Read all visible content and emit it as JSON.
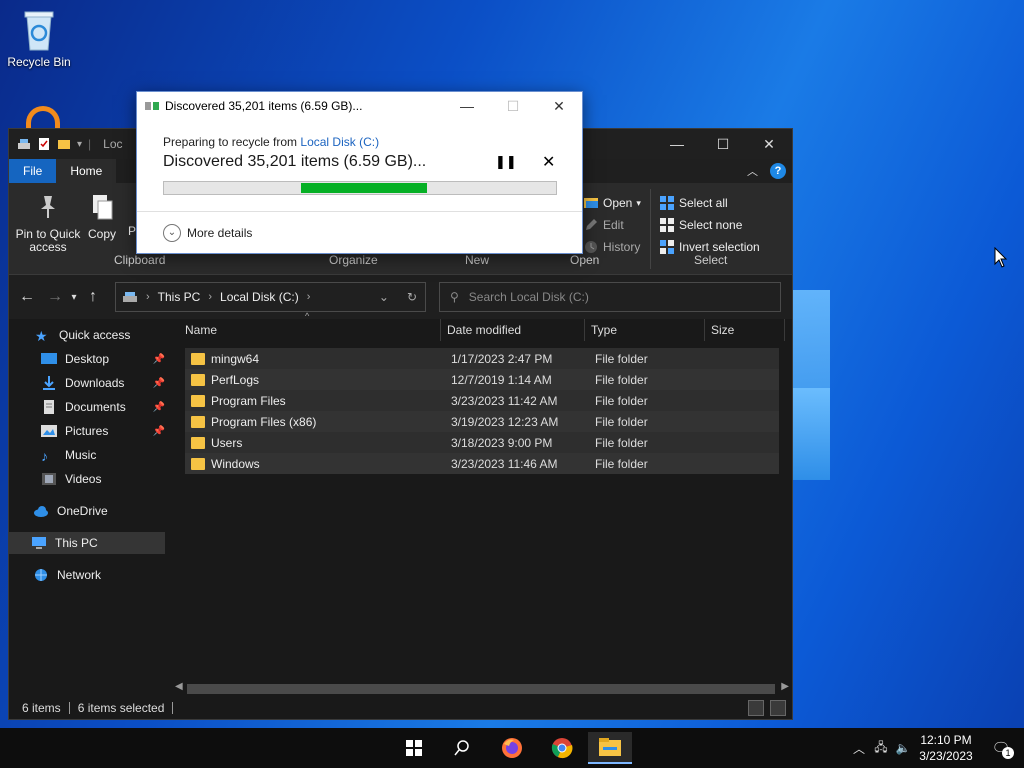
{
  "desktop": {
    "icons": [
      {
        "label": "Recycle Bin"
      }
    ]
  },
  "explorer": {
    "title_short": "Loc",
    "tabs": [
      "File",
      "Home"
    ],
    "ribbon": {
      "pin_label_1": "Pin to Quick",
      "pin_label_2": "access",
      "copy_label": "Copy",
      "paste_label": "P",
      "open_label": "Open",
      "edit_label": "Edit",
      "history_label": "History",
      "select_all": "Select all",
      "select_none": "Select none",
      "invert_selection": "Invert selection",
      "groups": {
        "clipboard": "Clipboard",
        "organize": "Organize",
        "new": "New",
        "open": "Open",
        "select": "Select"
      }
    },
    "address": {
      "parts": [
        "This PC",
        "Local Disk (C:)"
      ]
    },
    "search": {
      "placeholder": "Search Local Disk (C:)"
    },
    "nav": {
      "quick_access": "Quick access",
      "items": [
        {
          "label": "Desktop",
          "pinned": true
        },
        {
          "label": "Downloads",
          "pinned": true
        },
        {
          "label": "Documents",
          "pinned": true
        },
        {
          "label": "Pictures",
          "pinned": true
        },
        {
          "label": "Music",
          "pinned": false
        },
        {
          "label": "Videos",
          "pinned": false
        }
      ],
      "onedrive": "OneDrive",
      "this_pc": "This PC",
      "network": "Network"
    },
    "columns": [
      "Name",
      "Date modified",
      "Type",
      "Size"
    ],
    "files": [
      {
        "name": "mingw64",
        "date": "1/17/2023 2:47 PM",
        "type": "File folder"
      },
      {
        "name": "PerfLogs",
        "date": "12/7/2019 1:14 AM",
        "type": "File folder"
      },
      {
        "name": "Program Files",
        "date": "3/23/2023 11:42 AM",
        "type": "File folder"
      },
      {
        "name": "Program Files (x86)",
        "date": "3/19/2023 12:23 AM",
        "type": "File folder"
      },
      {
        "name": "Users",
        "date": "3/18/2023 9:00 PM",
        "type": "File folder"
      },
      {
        "name": "Windows",
        "date": "3/23/2023 11:46 AM",
        "type": "File folder"
      }
    ],
    "status": {
      "items": "6 items",
      "selected": "6 items selected"
    }
  },
  "dialog": {
    "title": "Discovered 35,201 items (6.59 GB)...",
    "from_prefix": "Preparing to recycle from",
    "from_link": "Local Disk (C:)",
    "status": "Discovered 35,201 items (6.59 GB)...",
    "more_details": "More details",
    "progress_start": 0.35,
    "progress_end": 0.67
  },
  "taskbar": {
    "time": "12:10 PM",
    "date": "3/23/2023",
    "notification_count": "1"
  }
}
